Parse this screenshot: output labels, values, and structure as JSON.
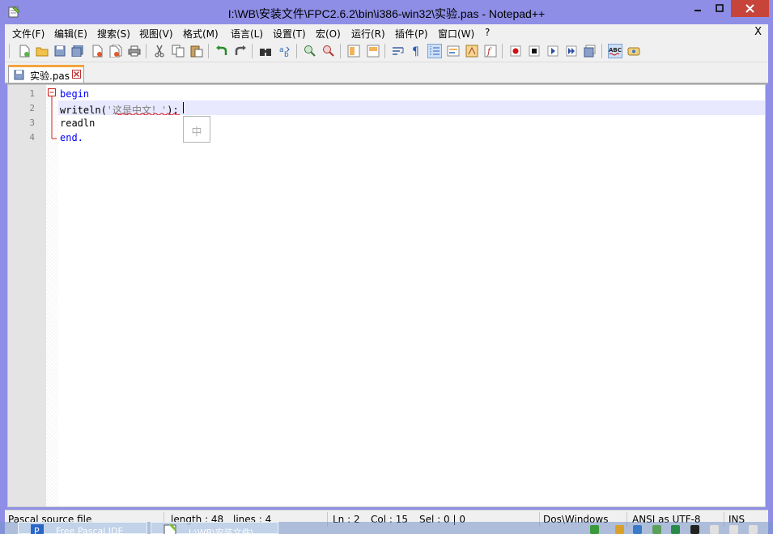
{
  "window": {
    "title": "I:\\WB\\安装文件\\FPC2.6.2\\bin\\i386-win32\\实验.pas - Notepad++",
    "close_glyph": "X"
  },
  "menu": [
    "文件(F)",
    "编辑(E)",
    "搜索(S)",
    "视图(V)",
    "格式(M)",
    "语言(L)",
    "设置(T)",
    "宏(O)",
    "运行(R)",
    "插件(P)",
    "窗口(W)",
    "?"
  ],
  "tab": {
    "label": "实验.pas"
  },
  "editor": {
    "line_numbers": [
      "1",
      "2",
      "3",
      "4"
    ],
    "lines": {
      "l1": "begin",
      "l2_pre": "writeln(",
      "l2_str": "'这是中文！'",
      "l2_post": ");",
      "l3": "readln",
      "l4": "end."
    },
    "ime_indicator": "中"
  },
  "status": {
    "file_type": "Pascal source file",
    "length": "length : 48",
    "lines": "lines : 4",
    "ln": "Ln : 2",
    "col": "Col : 15",
    "sel": "Sel : 0 | 0",
    "eol": "Dos\\Windows",
    "encoding": "ANSI as UTF-8",
    "mode": "INS"
  },
  "taskbar": {
    "items": [
      "Free Pascal IDE",
      "I:\\WB\\安装文件\\..."
    ]
  },
  "colors": {
    "title_bg": "#8e8ee6",
    "close_btn": "#c7443a",
    "tab_accent": "#f5a33e",
    "keyword": "#0000ff",
    "current_line": "#e8e8ff"
  }
}
